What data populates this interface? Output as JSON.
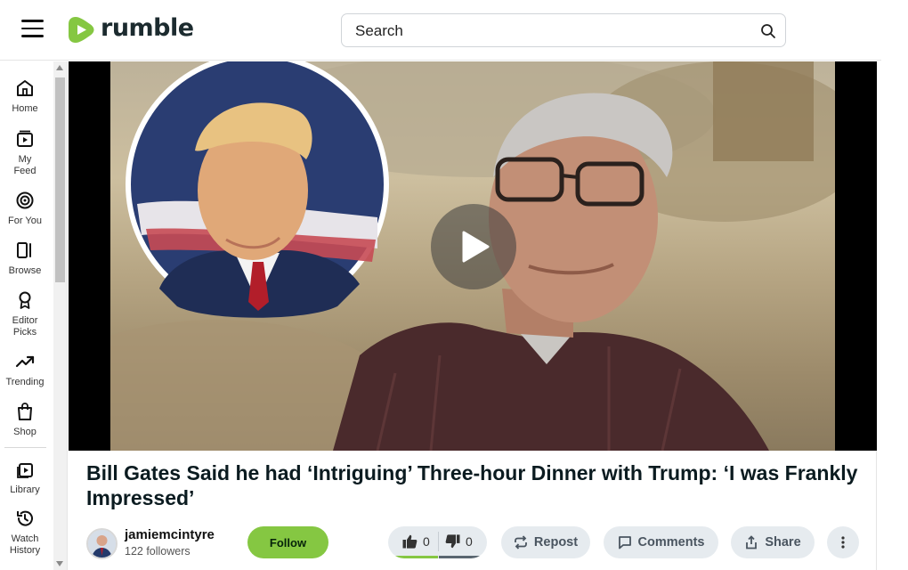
{
  "header": {
    "menu_icon": "hamburger-menu-icon",
    "logo_text": "rumble",
    "search": {
      "placeholder": "Search",
      "value": ""
    },
    "search_icon": "search-icon"
  },
  "sidebar": {
    "items": [
      {
        "label": "Home",
        "icon": "home-icon"
      },
      {
        "label": "My\nFeed",
        "icon": "feed-icon"
      },
      {
        "label": "For You",
        "icon": "target-icon"
      },
      {
        "label": "Browse",
        "icon": "browse-icon"
      },
      {
        "label": "Editor\nPicks",
        "icon": "award-icon"
      },
      {
        "label": "Trending",
        "icon": "trending-icon"
      },
      {
        "label": "Shop",
        "icon": "shopping-bag-icon"
      },
      {
        "label": "Library",
        "icon": "library-icon"
      },
      {
        "label": "Watch\nHistory",
        "icon": "history-icon"
      }
    ]
  },
  "video": {
    "title": "Bill Gates Said he had ‘Intriguing’ Three-hour Dinner with Trump: ‘I was Frankly Impressed’",
    "play_icon": "play-icon"
  },
  "channel": {
    "name": "jamiemcintyre",
    "followers": "122 followers",
    "follow_label": "Follow"
  },
  "actions": {
    "upvotes": "0",
    "downvotes": "0",
    "repost_label": "Repost",
    "comments_label": "Comments",
    "share_label": "Share"
  },
  "colors": {
    "brand_green": "#85c742",
    "pill_bg": "#e6ebef",
    "title_text": "#0b1b20"
  }
}
